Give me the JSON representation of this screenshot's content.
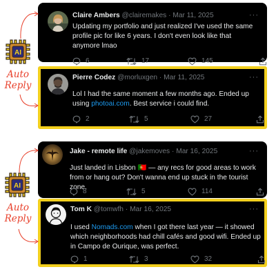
{
  "threads": [
    {
      "original": {
        "name": "Claire Ambers",
        "handle": "@clairemakes",
        "sep": "·",
        "date": "Mar 11, 2025",
        "more": "···",
        "text": "Updating my portfolio and just realized I've used the same profile pic for like 6 years. I don't even look like that anymore lmao",
        "replies": "6",
        "retweets": "17",
        "likes": "145"
      },
      "reply": {
        "name": "Pierre Codez",
        "handle": "@morluxgen",
        "sep": "·",
        "date": "Mar 11, 2025",
        "more": "···",
        "text_before": "Lol I had the same moment a few months ago. Ended up using ",
        "link": "photoai.com",
        "text_after": ". Best service i could find.",
        "replies": "2",
        "retweets": "5",
        "likes": "27"
      }
    },
    {
      "original": {
        "name": "Jake - remote life",
        "handle": "@jakemoves",
        "sep": "·",
        "date": "Mar 16, 2025",
        "more": "···",
        "text_before": "Just landed in Lisbon ",
        "flag": "🇵🇹",
        "text_after": " — any recs for good areas to work from or hang out? Don't wanna end up stuck in the tourist zone.",
        "replies": "8",
        "retweets": "5",
        "likes": "114"
      },
      "reply": {
        "name": "Tom K",
        "handle": "@tomwfh",
        "sep": "·",
        "date": "Mar 16, 2025",
        "more": "···",
        "text_before": "I used ",
        "link": "Nomads.com",
        "text_after": " when I got there last year — it showed which neighborhoods had chill cafés and good wifi. Ended up in Campo de Ourique, was perfect.",
        "replies": "1",
        "retweets": "3",
        "likes": "32"
      }
    }
  ],
  "annotation": {
    "chip_text": "AI",
    "label_line1": "Auto",
    "label_line2": "Reply",
    "chip_icon": "ai-chip-icon",
    "accent_color": "#f2cf1d",
    "label_color": "#e8412c"
  },
  "icons": {
    "reply": "reply-bubble-icon",
    "retweet": "retweet-icon",
    "like": "heart-icon",
    "share": "share-icon"
  }
}
